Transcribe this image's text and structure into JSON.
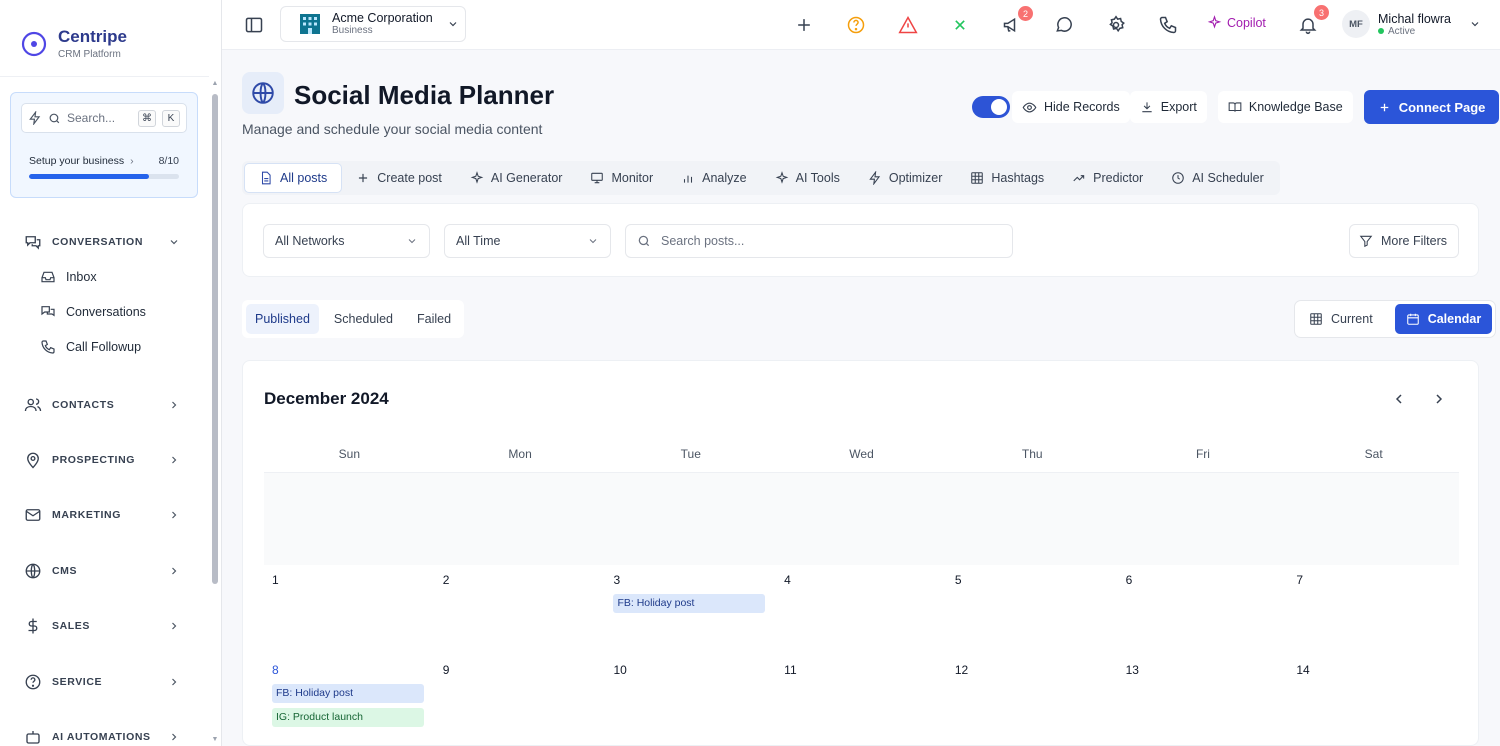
{
  "brand": {
    "name": "Centripe",
    "subtitle": "CRM Platform"
  },
  "sidebar": {
    "search_placeholder": "Search...",
    "kbd_cmd": "⌘",
    "kbd_key": "K",
    "setup": {
      "label": "Setup your business",
      "count": "8/10",
      "progress": 0.8
    },
    "sections": [
      {
        "label": "CONVERSATION",
        "icon": "chat-icon",
        "expanded": true,
        "items": [
          {
            "label": "Inbox",
            "icon": "inbox-icon"
          },
          {
            "label": "Conversations",
            "icon": "messages-icon"
          },
          {
            "label": "Call Followup",
            "icon": "phone-icon"
          }
        ]
      },
      {
        "label": "CONTACTS",
        "icon": "users-icon"
      },
      {
        "label": "PROSPECTING",
        "icon": "map-pin-icon"
      },
      {
        "label": "MARKETING",
        "icon": "mail-icon"
      },
      {
        "label": "CMS",
        "icon": "globe-icon"
      },
      {
        "label": "SALES",
        "icon": "dollar-icon"
      },
      {
        "label": "SERVICE",
        "icon": "help-icon"
      },
      {
        "label": "AI AUTOMATIONS",
        "icon": "robot-icon"
      }
    ]
  },
  "topbar": {
    "org_name": "Acme Corporation",
    "org_type": "Business",
    "announce_badge": "2",
    "notif_badge": "3",
    "copilot_label": "Copilot",
    "user": {
      "initials": "MF",
      "name": "Michal flowra",
      "status": "Active"
    },
    "colors": {
      "help": "#f59e0b",
      "alert": "#ef4444",
      "close": "#22c55e",
      "copilot": "#a21caf"
    }
  },
  "page": {
    "title": "Social Media Planner",
    "subtitle": "Manage and schedule your social media content",
    "hide_records_label": "Hide Records",
    "export_label": "Export",
    "kb_label": "Knowledge Base",
    "connect_label": "Connect Page",
    "accent": "#2b55d9"
  },
  "tabs": [
    {
      "label": "All posts",
      "icon": "file-icon",
      "active": true
    },
    {
      "label": "Create post",
      "icon": "plus-icon"
    },
    {
      "label": "AI Generator",
      "icon": "sparkle-icon"
    },
    {
      "label": "Monitor",
      "icon": "monitor-icon"
    },
    {
      "label": "Analyze",
      "icon": "bar-chart-icon"
    },
    {
      "label": "AI Tools",
      "icon": "sparkle-icon"
    },
    {
      "label": "Optimizer",
      "icon": "bolt-icon"
    },
    {
      "label": "Hashtags",
      "icon": "grid-icon"
    },
    {
      "label": "Predictor",
      "icon": "trend-icon"
    },
    {
      "label": "AI Scheduler",
      "icon": "clock-icon"
    }
  ],
  "filters": {
    "network": "All Networks",
    "time": "All Time",
    "search_placeholder": "Search posts...",
    "more_label": "More Filters"
  },
  "status_tabs": [
    "Published",
    "Scheduled",
    "Failed"
  ],
  "view_toggle": {
    "current": "Current",
    "calendar": "Calendar"
  },
  "calendar": {
    "month": "December 2024",
    "weekdays": [
      "Sun",
      "Mon",
      "Tue",
      "Wed",
      "Thu",
      "Fri",
      "Sat"
    ],
    "weeks": [
      [
        {
          "n": ""
        },
        {
          "n": ""
        },
        {
          "n": ""
        },
        {
          "n": ""
        },
        {
          "n": ""
        },
        {
          "n": ""
        },
        {
          "n": ""
        }
      ],
      [
        {
          "n": "1"
        },
        {
          "n": "2"
        },
        {
          "n": "3",
          "events": [
            {
              "label": "FB: Holiday post",
              "kind": "fb"
            }
          ]
        },
        {
          "n": "4"
        },
        {
          "n": "5"
        },
        {
          "n": "6"
        },
        {
          "n": "7"
        }
      ],
      [
        {
          "n": "8",
          "today": true,
          "events": [
            {
              "label": "FB: Holiday post",
              "kind": "fb"
            },
            {
              "label": "IG: Product launch",
              "kind": "ig"
            }
          ]
        },
        {
          "n": "9"
        },
        {
          "n": "10"
        },
        {
          "n": "11"
        },
        {
          "n": "12"
        },
        {
          "n": "13"
        },
        {
          "n": "14"
        }
      ]
    ]
  }
}
